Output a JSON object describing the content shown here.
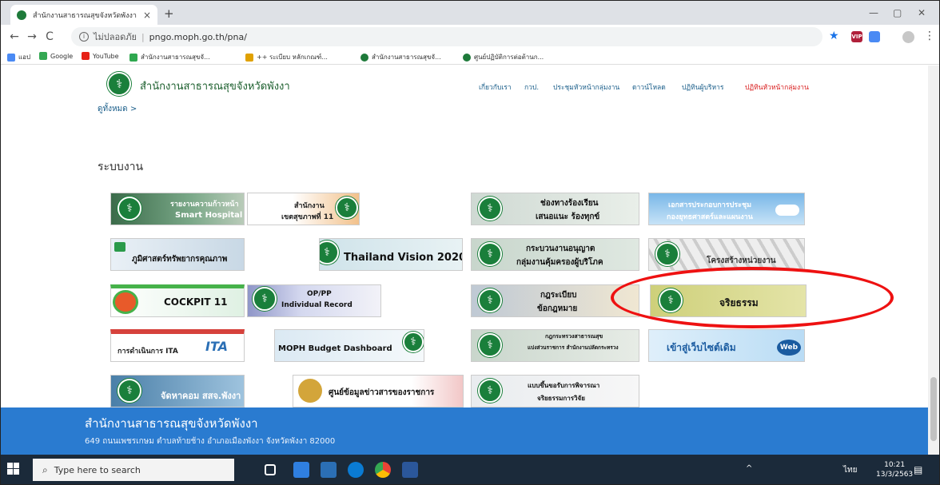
{
  "browser": {
    "tab_title": "สำนักงานสาธารณสุขจังหวัดพังงา",
    "new_tab": "+",
    "close": "×",
    "window_min": "—",
    "window_max": "▢",
    "window_close": "✕",
    "security": "ไม่ปลอดภัย",
    "url_sep": "|",
    "url": "pngo.moph.go.th/pna/",
    "bookmarks": [
      "แอป",
      "Google",
      "YouTube",
      "สำนักงานสาธารณสุขจั...",
      "++ ระเบียบ หลักเกณฑ์...",
      "สำนักงานสาธารณสุขจั...",
      "ศูนย์ปฏิบัติการต่อต้านก..."
    ]
  },
  "site": {
    "name": "สำนักงานสาธารณสุขจังหวัดพังงา",
    "nav": [
      "เกี่ยวกับเรา",
      "กวป.",
      "ประชุมหัวหน้ากลุ่มงาน",
      "ดาวน์โหลด",
      "ปฏิทินผู้บริหาร",
      "ปฏิทินหัวหน้ากลุ่มงาน"
    ],
    "see_all": "ดูทั้งหมด >",
    "section_title": "ระบบงาน"
  },
  "tiles": [
    {
      "l1": "รายงานความก้าวหน้า",
      "l2": "Smart Hospital"
    },
    {
      "l1": "สำนักงาน",
      "l2": "เขตสุขภาพที่ 11"
    },
    {
      "l1": "ช่องทางร้องเรียน",
      "l2": "เสนอแนะ ร้องทุกข์"
    },
    {
      "l1": "เอกสารประกอบการประชุม",
      "l2": "กองยุทธศาสตร์และแผนงาน"
    },
    {
      "l1": "ภูมิศาสตร์ทรัพยากรคุณภาพ",
      "l2": ""
    },
    {
      "l1": "Thailand Vision 2020",
      "l2": ""
    },
    {
      "l1": "กระบวนงานอนุญาต",
      "l2": "กลุ่มงานคุ้มครองผู้บริโภค"
    },
    {
      "l1": "โครงสร้างหน่วยงาน",
      "l2": ""
    },
    {
      "l1": "COCKPIT 11",
      "l2": ""
    },
    {
      "l1": "OP/PP",
      "l2": "Individual Record"
    },
    {
      "l1": "กฎระเบียบ",
      "l2": "ข้อกฎหมาย"
    },
    {
      "l1": "จริยธรรม",
      "l2": ""
    },
    {
      "l1": "การดำเนินการ ITA",
      "l2": "ITA"
    },
    {
      "l1": "MOPH Budget Dashboard",
      "l2": ""
    },
    {
      "l1": "กฎกระทรวงสาธารณสุข",
      "l2": "แบ่งส่วนราชการ สำนักงานปลัดกระทรวง"
    },
    {
      "l1": "เข้าสู่เว็บไซต์เดิม",
      "l2": "Web"
    },
    {
      "l1": "จัดหาคอม สสจ.พังงา",
      "l2": ""
    },
    {
      "l1": "ศูนย์ข้อมูลข่าวสารของราชการ",
      "l2": ""
    },
    {
      "l1": "แบบขึ้นขอรับการพิจารณา",
      "l2": "จริยธรรมการวิจัย"
    }
  ],
  "footer": {
    "title": "สำนักงานสาธารณสุขจังหวัดพังงา",
    "address": "649 ถนนเพชรเกษม ตำบลท้ายช้าง อำเภอเมืองพังงา จังหวัดพังงา 82000"
  },
  "taskbar": {
    "search_placeholder": "Type here to search",
    "lang": "ไทย",
    "time": "10:21",
    "date": "13/3/2563"
  }
}
